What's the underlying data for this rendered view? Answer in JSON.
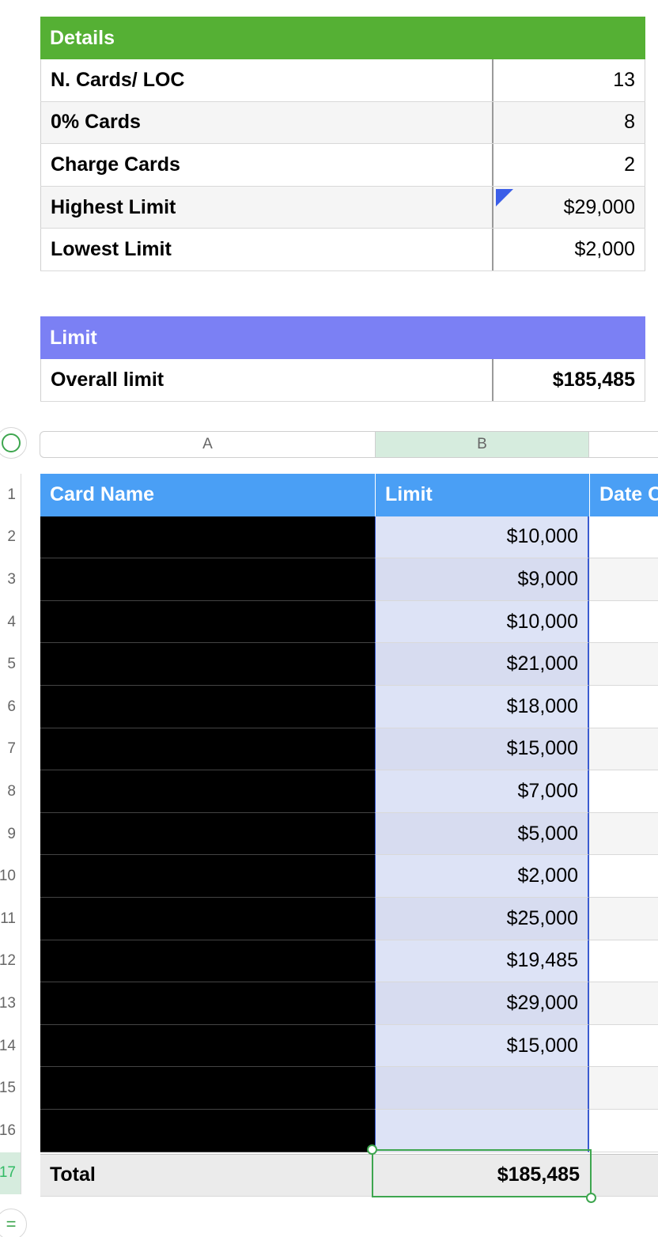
{
  "details": {
    "title": "Details",
    "header_color": "#55b034",
    "rows": [
      {
        "label": "N. Cards/ LOC",
        "value": "13"
      },
      {
        "label": "0% Cards",
        "value": "8"
      },
      {
        "label": "Charge Cards",
        "value": "2"
      },
      {
        "label": "Highest Limit",
        "value": "$29,000"
      },
      {
        "label": "Lowest Limit",
        "value": "$2,000"
      }
    ]
  },
  "limit_table": {
    "title": "Limit",
    "header_color": "#7b80f4",
    "label": "Overall limit",
    "value": "$185,485"
  },
  "sheet": {
    "columns": [
      "A",
      "B"
    ],
    "headers": [
      "Card Name",
      "Limit",
      "Date C"
    ],
    "row_numbers": [
      "1",
      "2",
      "3",
      "4",
      "5",
      "6",
      "7",
      "8",
      "9",
      "10",
      "11",
      "12",
      "13",
      "14",
      "15",
      "16",
      "17"
    ],
    "limits": [
      "$10,000",
      "$9,000",
      "$10,000",
      "$21,000",
      "$18,000",
      "$15,000",
      "$7,000",
      "$5,000",
      "$2,000",
      "$25,000",
      "$19,485",
      "$29,000",
      "$15,000",
      "",
      ""
    ],
    "total_label": "Total",
    "total_value": "$185,485",
    "header_color": "#4a9ff5",
    "selection_color": "#3ea64f"
  },
  "icons": {
    "select_all": "circle-icon",
    "comment": "comment-triangle-icon",
    "table_menu": "equals-icon"
  }
}
